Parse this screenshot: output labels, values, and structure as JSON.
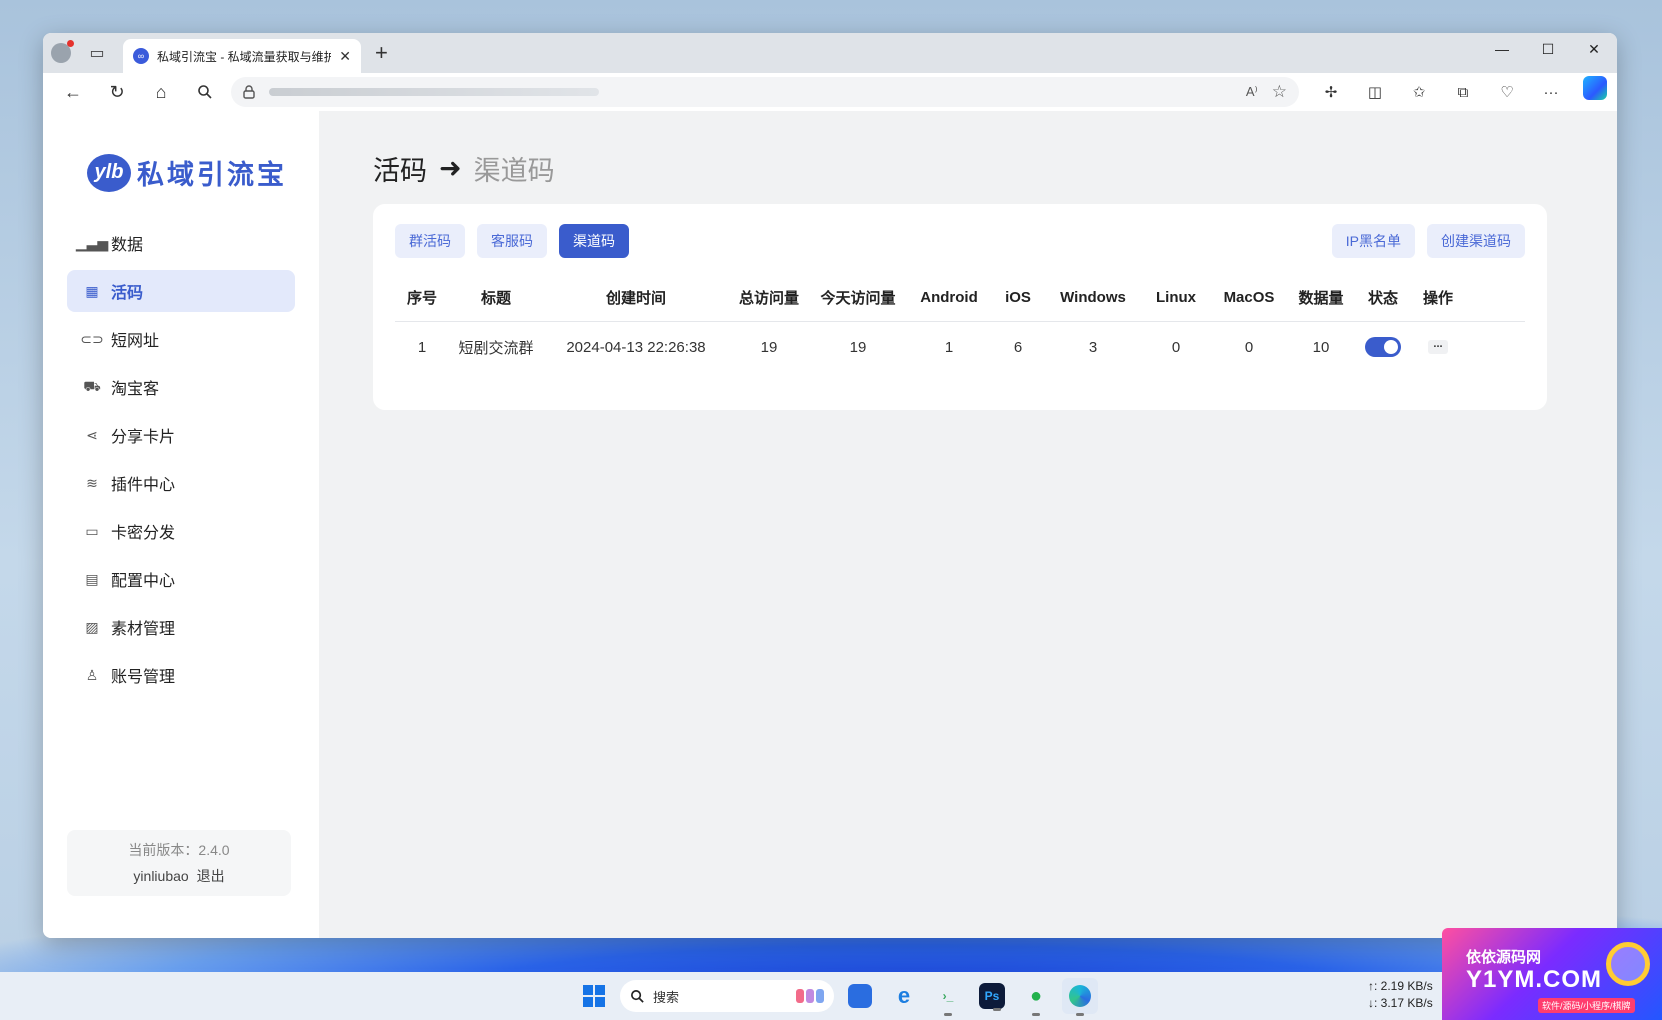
{
  "browser": {
    "tab_title": "私域引流宝 - 私域流量获取与维护",
    "tab_favicon": "ylb-favicon",
    "new_tab_symbol": "+",
    "window_controls": {
      "minimize": "—",
      "maximize": "☐",
      "close": "✕"
    }
  },
  "sidebar": {
    "logo_badge": "ylb",
    "logo_text": "私域引流宝",
    "items": [
      {
        "label": "数据",
        "icon": "chart-icon"
      },
      {
        "label": "活码",
        "icon": "grid-icon",
        "active": true
      },
      {
        "label": "短网址",
        "icon": "link-icon"
      },
      {
        "label": "淘宝客",
        "icon": "cart-icon"
      },
      {
        "label": "分享卡片",
        "icon": "share-icon"
      },
      {
        "label": "插件中心",
        "icon": "layers-icon"
      },
      {
        "label": "卡密分发",
        "icon": "card-icon"
      },
      {
        "label": "配置中心",
        "icon": "settings-icon"
      },
      {
        "label": "素材管理",
        "icon": "image-icon"
      },
      {
        "label": "账号管理",
        "icon": "user-add-icon"
      }
    ],
    "version_label": "当前版本：2.4.0",
    "username": "yinliubao",
    "logout_label": "退出"
  },
  "main": {
    "breadcrumb": {
      "current": "活码",
      "arrow": "➜",
      "sub": "渠道码"
    },
    "tabs": [
      {
        "label": "群活码"
      },
      {
        "label": "客服码"
      },
      {
        "label": "渠道码",
        "active": true
      }
    ],
    "actions": {
      "ip_blacklist": "IP黑名单",
      "create": "创建渠道码"
    },
    "table": {
      "columns": [
        "序号",
        "标题",
        "创建时间",
        "总访问量",
        "今天访问量",
        "Android",
        "iOS",
        "Windows",
        "Linux",
        "MacOS",
        "数据量",
        "状态",
        "操作"
      ],
      "rows": [
        {
          "index": "1",
          "title": "短剧交流群",
          "created": "2024-04-13 22:26:38",
          "total": "19",
          "today": "19",
          "android": "1",
          "ios": "6",
          "windows": "3",
          "linux": "0",
          "macos": "0",
          "data": "10",
          "status_on": true,
          "more": "..."
        }
      ]
    }
  },
  "taskbar": {
    "search_label": "搜索",
    "net_up": "↑: 2.19 KB/s",
    "net_down": "↓: 3.17 KB/s",
    "ps_label": "Ps"
  },
  "promo": {
    "line1": "依依源码网",
    "line2": "Y1YM.COM",
    "line3": "软件/源码/小程序/棋牌"
  },
  "colors": {
    "accent": "#3a5ccc",
    "chip_bg": "#eaeefb"
  }
}
